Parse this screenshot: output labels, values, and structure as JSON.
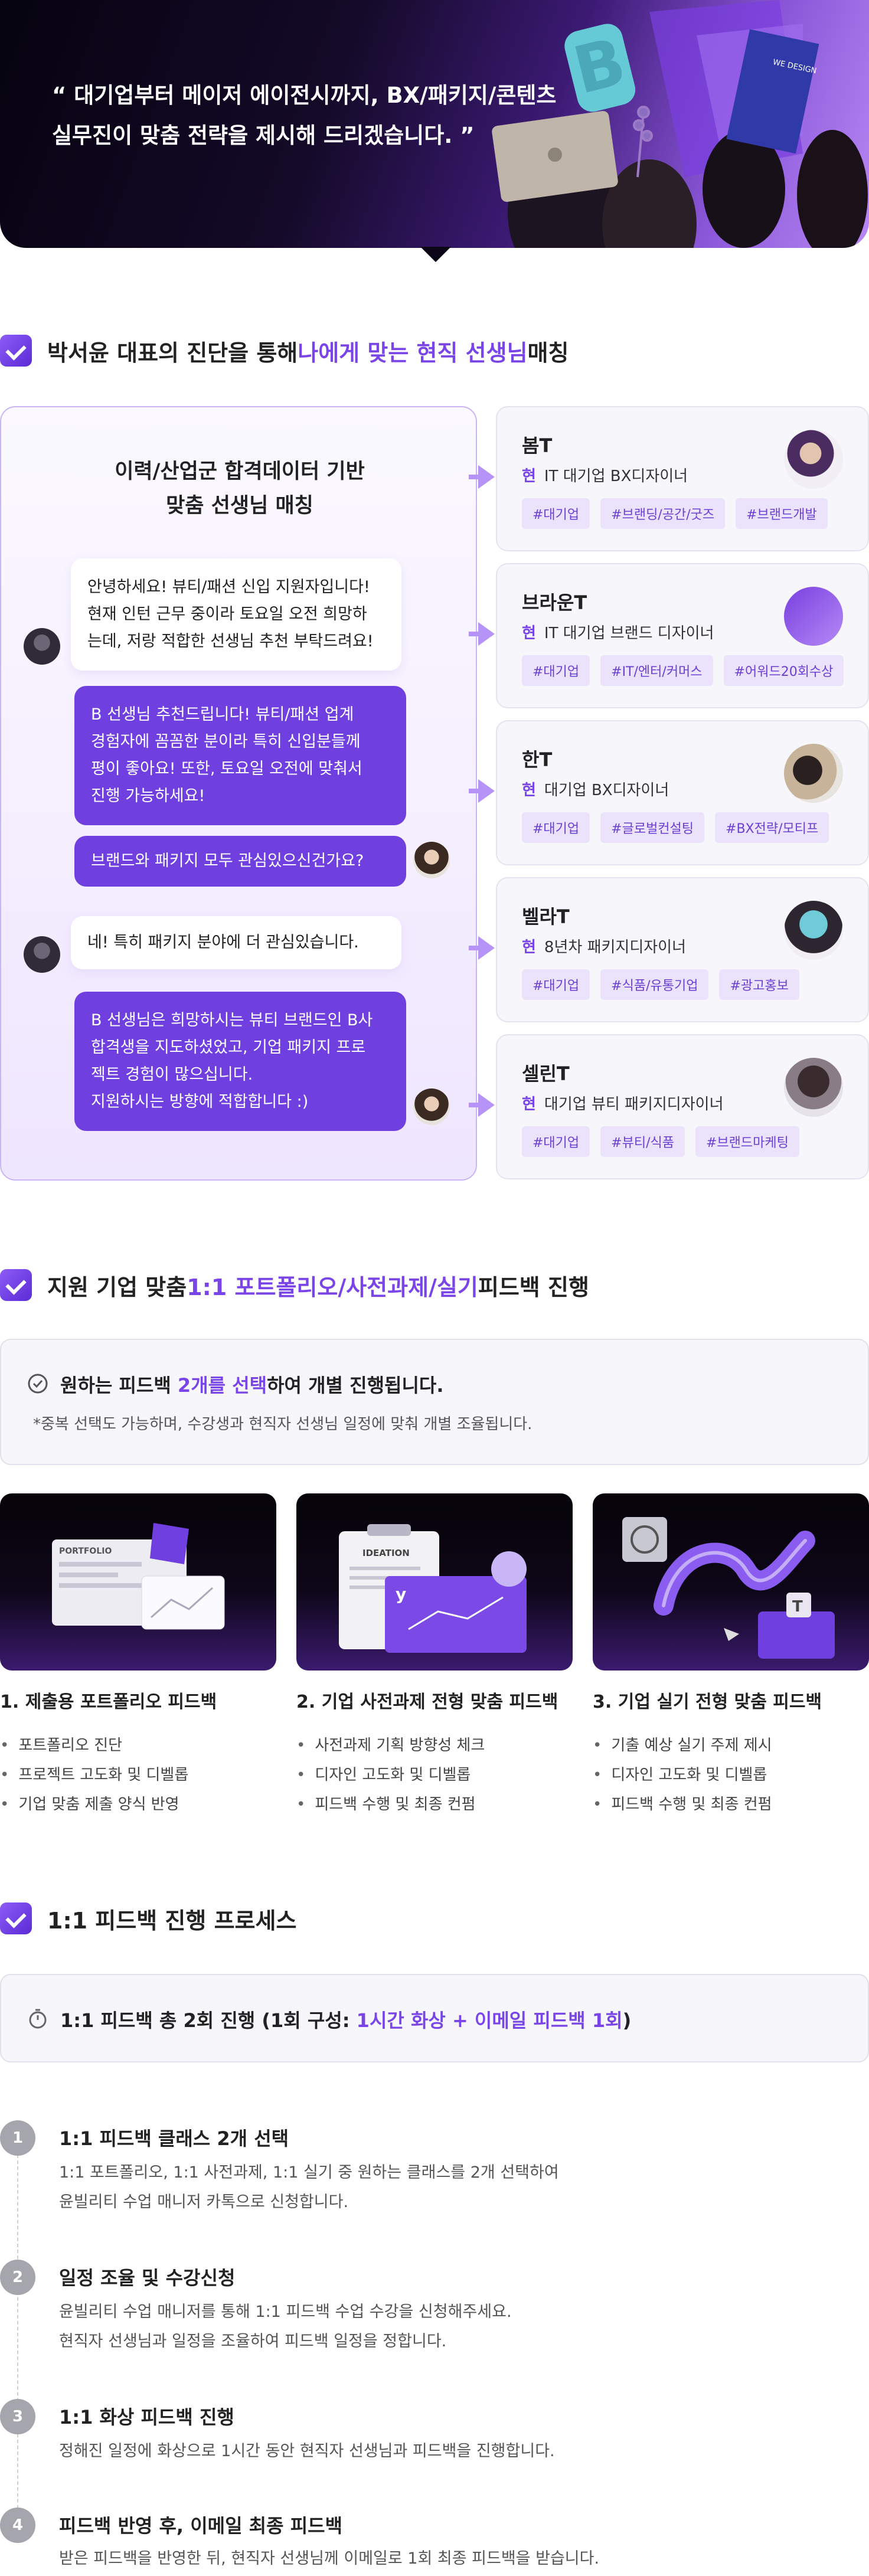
{
  "hero": {
    "quote": "“ 대기업부터 메이저 에이전시까지, BX/패키지/콘텐츠\n실무진이 맞춤 전략을 제시해 드리겠습니다. ”",
    "laptop_text": "WE DESIGN",
    "letter": "B"
  },
  "section1": {
    "title_pre": "박서윤 대표의 진단을 통해 ",
    "title_highlight": "나에게 맞는 현직 선생님",
    "title_post": " 매칭",
    "chat": {
      "title": "이력/산업군 합격데이터 기반\n맞춤 선생님 매칭",
      "messages": [
        {
          "from": "student",
          "text": "안녕하세요! 뷰티/패션 신입 지원자입니다!\n현재 인턴 근무 중이라 토요일 오전 희망하\n는데, 저랑 적합한 선생님 추천 부탁드려요!"
        },
        {
          "from": "mentor",
          "text": "B 선생님 추천드립니다! 뷰티/패션 업계\n경험자에 꼼꼼한 분이라 특히 신입분들께\n평이 좋아요! 또한, 토요일 오전에 맞춰서\n진행 가능하세요!"
        },
        {
          "from": "mentor",
          "text": "브랜드와 패키지 모두 관심있으신건가요?"
        },
        {
          "from": "student",
          "text": "네! 특히 패키지 분야에 더 관심있습니다."
        },
        {
          "from": "mentor",
          "text": "B 선생님은 희망하시는 뷰티 브랜드인 B사\n합격생을 지도하셨었고, 기업 패키지 프로\n젝트 경험이 많으십니다.\n지원하시는 방향에 적합합니다 :)"
        }
      ]
    },
    "teachers": [
      {
        "name": "봄T",
        "current": "현",
        "role": "IT 대기업 BX디자이너",
        "tags": [
          "#대기업",
          "#브랜딩/공간/굿즈",
          "#브랜드개발"
        ]
      },
      {
        "name": "브라운T",
        "current": "현",
        "role": "IT 대기업 브랜드 디자이너",
        "tags": [
          "#대기업",
          "#IT/엔터/커머스",
          "#어워드20회수상"
        ]
      },
      {
        "name": "한T",
        "current": "현",
        "role": "대기업 BX디자이너",
        "tags": [
          "#대기업",
          "#글로벌컨설팅",
          "#BX전략/모티프"
        ]
      },
      {
        "name": "벨라T",
        "current": "현",
        "role": "8년차 패키지디자이너",
        "tags": [
          "#대기업",
          "#식품/유통기업",
          "#광고홍보"
        ]
      },
      {
        "name": "셀린T",
        "current": "현",
        "role": "대기업 뷰티 패키지디자이너",
        "tags": [
          "#대기업",
          "#뷰티/식품",
          "#브랜드마케팅"
        ]
      }
    ]
  },
  "section2": {
    "title_pre": "지원 기업 맞춤 ",
    "title_highlight": "1:1 포트폴리오/사전과제/실기",
    "title_post": " 피드백 진행",
    "info_pre": "원하는 피드백 ",
    "info_highlight": "2개를 선택",
    "info_post": "하여 개별 진행됩니다.",
    "info_sub": "*중복 선택도 가능하며, 수강생과 현직자 선생님 일정에 맞춰 개별 조율됩니다.",
    "features": [
      {
        "thumb_label": "PORTFOLIO",
        "title": "1. 제출용 포트폴리오 피드백",
        "items": [
          "포트폴리오 진단",
          "프로젝트 고도화 및 디벨롭",
          "기업 맞춤 제출 양식 반영"
        ]
      },
      {
        "thumb_label": "IDEATION",
        "title": "2. 기업 사전과제 전형 맞춤 피드백",
        "items": [
          "사전과제 기획 방향성 체크",
          "디자인 고도화 및 디벨롭",
          "피드백 수행 및 최종 컨펌"
        ]
      },
      {
        "thumb_label": "",
        "title": "3. 기업 실기 전형 맞춤 피드백",
        "items": [
          "기출 예상 실기 주제 제시",
          "디자인 고도화 및 디벨롭",
          "피드백 수행 및 최종 컨펌"
        ]
      }
    ]
  },
  "section3": {
    "title": "1:1 피드백 진행 프로세스",
    "info_pre": "1:1 피드백 총 2회 진행 (1회 구성: ",
    "info_highlight": "1시간 화상 + 이메일 피드백 1회",
    "info_post": ")",
    "steps": [
      {
        "num": "1",
        "title": "1:1 피드백 클래스 2개 선택",
        "desc": "1:1 포트폴리오, 1:1 사전과제, 1:1 실기 중 원하는 클래스를 2개 선택하여\n윤빌리티 수업 매니저 카톡으로 신청합니다."
      },
      {
        "num": "2",
        "title": "일정 조율 및 수강신청",
        "desc": "윤빌리티 수업 매니저를 통해 1:1 피드백 수업 수강을 신청해주세요.\n현직자 선생님과 일정을 조율하여 피드백 일정을 정합니다."
      },
      {
        "num": "3",
        "title": "1:1 화상 피드백 진행",
        "desc": "정해진 일정에 화상으로 1시간 동안 현직자 선생님과 피드백을 진행합니다."
      },
      {
        "num": "4",
        "title": "피드백 반영 후, 이메일 최종 피드백",
        "desc": "받은 피드백을 반영한 뒤, 현직자 선생님께 이메일로 1회 최종 피드백을 받습니다."
      }
    ]
  }
}
